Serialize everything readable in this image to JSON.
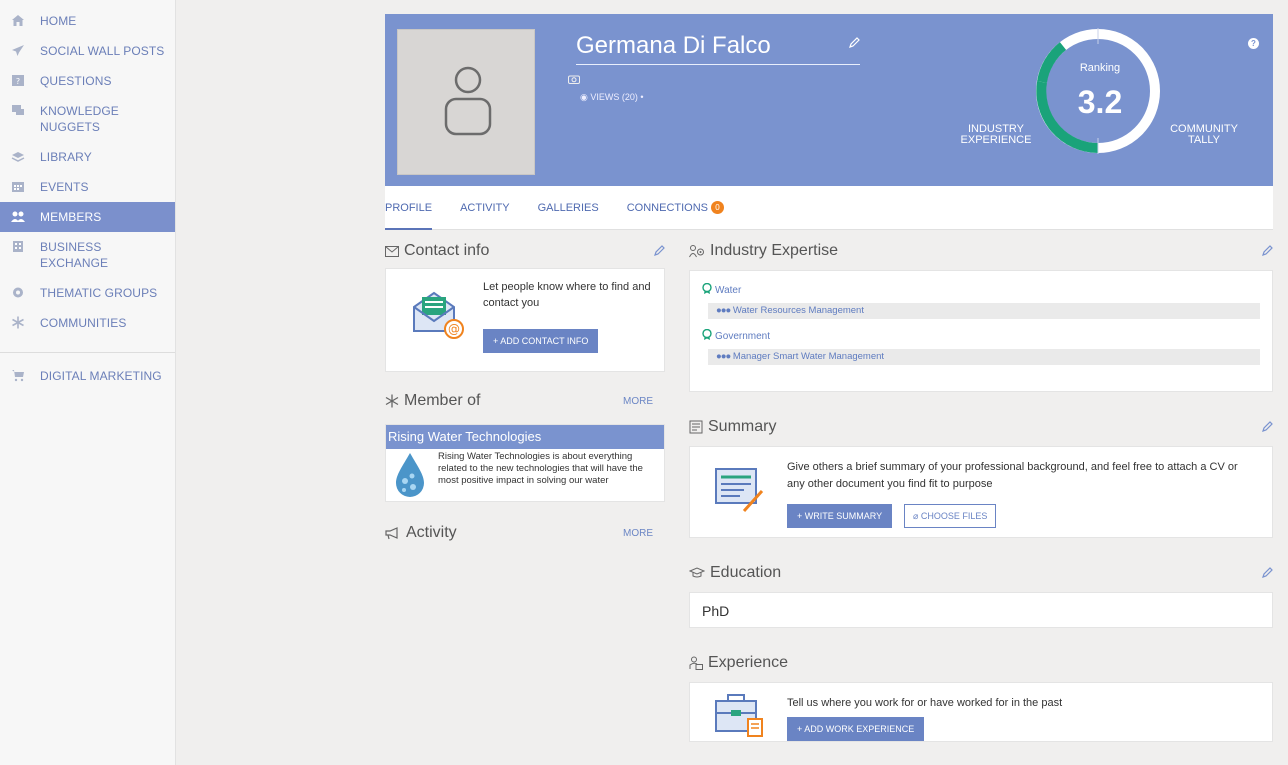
{
  "sidebar": {
    "items": [
      {
        "label": "HOME",
        "icon": "home-icon"
      },
      {
        "label": "SOCIAL WALL POSTS",
        "icon": "paper-plane-icon"
      },
      {
        "label": "QUESTIONS",
        "icon": "question-icon"
      },
      {
        "label": "KNOWLEDGE NUGGETS",
        "icon": "chat-bubbles-icon"
      },
      {
        "label": "LIBRARY",
        "icon": "stack-icon"
      },
      {
        "label": "EVENTS",
        "icon": "calendar-icon"
      },
      {
        "label": "MEMBERS",
        "icon": "members-icon",
        "active": true
      },
      {
        "label": "BUSINESS EXCHANGE",
        "icon": "building-icon"
      },
      {
        "label": "THEMATIC GROUPS",
        "icon": "cog-icon"
      },
      {
        "label": "COMMUNITIES",
        "icon": "snowflake-icon"
      }
    ],
    "footer_item": {
      "label": "DIGITAL MARKETING",
      "icon": "cart-icon"
    }
  },
  "profile": {
    "name": "Germana Di Falco",
    "views": "VIEWS (20)",
    "views_suffix": "•",
    "ranking_label": "Ranking",
    "ranking_value": "3.2",
    "industry_experience_label": "INDUSTRY EXPERIENCE",
    "community_tally_label": "COMMUNITY TALLY",
    "help": "?"
  },
  "tabs": [
    {
      "label": "PROFILE",
      "active": true
    },
    {
      "label": "ACTIVITY"
    },
    {
      "label": "GALLERIES"
    },
    {
      "label": "CONNECTIONS",
      "badge": "0"
    }
  ],
  "contact": {
    "title": "Contact info",
    "text": "Let people know where to find and contact you",
    "button": "+ ADD CONTACT INFO"
  },
  "member_of": {
    "title": "Member of",
    "more": "MORE",
    "group_name": "Rising Water Technologies",
    "group_desc": "Rising Water Technologies is about everything related to the new technologies that will have the most positive impact in solving our water"
  },
  "activity": {
    "title": "Activity",
    "more": "MORE"
  },
  "industry_expertise": {
    "title": "Industry Expertise",
    "entries": [
      {
        "industry": "Water",
        "sub": "Water Resources Management"
      },
      {
        "industry": "Government",
        "sub": "Manager Smart Water Management"
      }
    ]
  },
  "summary": {
    "title": "Summary",
    "text": "Give others a brief summary of your professional background, and feel free to attach a CV or any other document you find fit to purpose",
    "button_write": "+ WRITE SUMMARY",
    "button_files": "CHOOSE FILES"
  },
  "education": {
    "title": "Education",
    "value": "PhD"
  },
  "experience": {
    "title": "Experience",
    "text": "Tell us where you work for or have worked for in the past",
    "button": "+ ADD WORK EXPERIENCE"
  },
  "colors": {
    "accent": "#7a93cf",
    "link": "#4f6ab0",
    "badge": "#f0831e",
    "gauge_green": "#1aa37a"
  }
}
